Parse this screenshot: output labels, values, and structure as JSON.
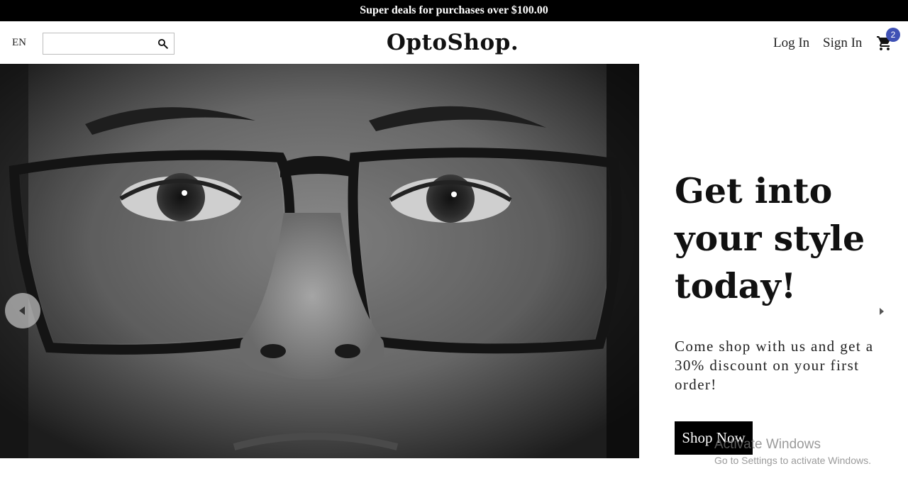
{
  "promo": {
    "text": "Super deals for purchases over $100.00"
  },
  "header": {
    "language": "EN",
    "search": {
      "value": "",
      "placeholder": ""
    },
    "logo": "OptoShop.",
    "login_label": "Log In",
    "signin_label": "Sign In",
    "cart_count": "2"
  },
  "hero": {
    "title_line1": "Get into",
    "title_line2": "your style",
    "title_line3": "today!",
    "description": "Come shop with us and get a 30% discount on your first order!",
    "button_label": "Shop Now"
  },
  "watermark": {
    "title": "Activate Windows",
    "subtitle": "Go to Settings to activate Windows."
  },
  "icons": {
    "search": "search-icon",
    "cart": "shopping-cart-icon",
    "prev": "chevron-left-icon",
    "next": "chevron-right-icon"
  },
  "colors": {
    "promo_bg": "#000000",
    "badge": "#3f51b5",
    "button_bg": "#000000"
  }
}
